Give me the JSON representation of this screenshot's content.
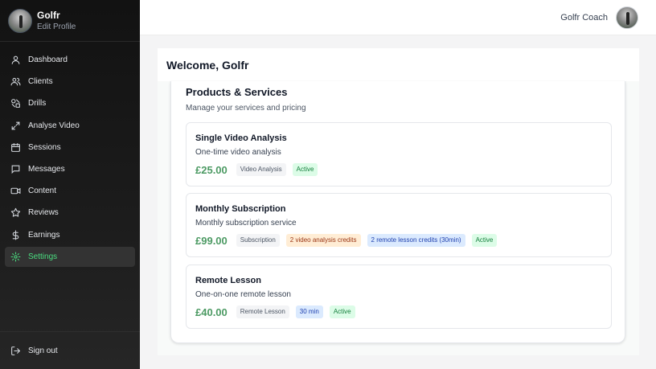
{
  "sidebar": {
    "user_name": "Golfr",
    "edit_profile": "Edit Profile",
    "items": [
      {
        "label": "Dashboard",
        "icon": "user-icon"
      },
      {
        "label": "Clients",
        "icon": "users-icon"
      },
      {
        "label": "Drills",
        "icon": "shapes-icon"
      },
      {
        "label": "Analyse Video",
        "icon": "expand-icon"
      },
      {
        "label": "Sessions",
        "icon": "calendar-icon"
      },
      {
        "label": "Messages",
        "icon": "chat-icon"
      },
      {
        "label": "Content",
        "icon": "video-icon"
      },
      {
        "label": "Reviews",
        "icon": "star-icon"
      },
      {
        "label": "Earnings",
        "icon": "dollar-icon"
      },
      {
        "label": "Settings",
        "icon": "gear-icon",
        "active": true
      }
    ],
    "sign_out": "Sign out"
  },
  "header": {
    "coach_name": "Golfr Coach"
  },
  "main": {
    "welcome": "Welcome, Golfr",
    "section_title": "Products & Services",
    "section_subtitle": "Manage your services and pricing",
    "products": [
      {
        "name": "Single Video Analysis",
        "description": "One-time video analysis",
        "price": "£25.00",
        "badges": [
          {
            "text": "Video Analysis",
            "style": "gray"
          },
          {
            "text": "Active",
            "style": "green"
          }
        ]
      },
      {
        "name": "Monthly Subscription",
        "description": "Monthly subscription service",
        "price": "£99.00",
        "badges": [
          {
            "text": "Subscription",
            "style": "gray"
          },
          {
            "text": "2 video analysis credits",
            "style": "orange"
          },
          {
            "text": "2 remote lesson credits (30min)",
            "style": "blue"
          },
          {
            "text": "Active",
            "style": "green"
          }
        ]
      },
      {
        "name": "Remote Lesson",
        "description": "One-on-one remote lesson",
        "price": "£40.00",
        "badges": [
          {
            "text": "Remote Lesson",
            "style": "gray"
          },
          {
            "text": "30 min",
            "style": "blue"
          },
          {
            "text": "Active",
            "style": "green"
          }
        ]
      }
    ]
  },
  "colors": {
    "accent_green": "#4ade80",
    "price_green": "#4c9a63",
    "sidebar_bg": "#121212"
  }
}
